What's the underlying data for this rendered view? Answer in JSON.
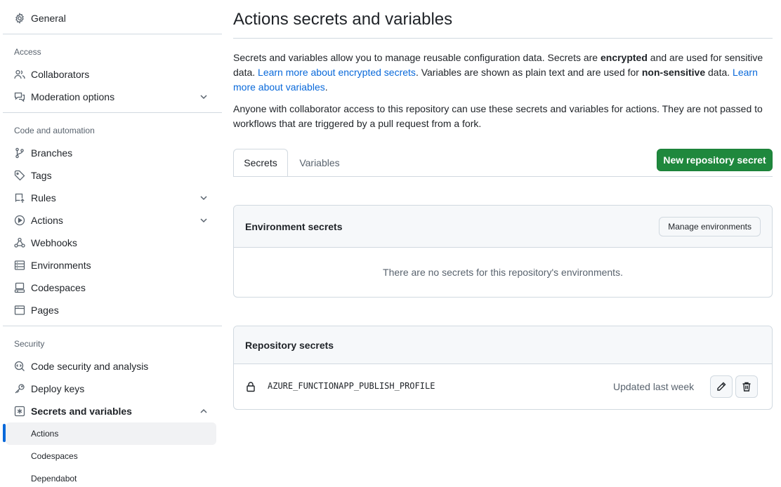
{
  "sidebar": {
    "top_item": {
      "label": "General",
      "icon": "gear-icon"
    },
    "sections": {
      "access": "Access",
      "code": "Code and automation",
      "security": "Security"
    },
    "items": {
      "collaborators": "Collaborators",
      "moderation": "Moderation options",
      "branches": "Branches",
      "tags": "Tags",
      "rules": "Rules",
      "actions": "Actions",
      "webhooks": "Webhooks",
      "environments": "Environments",
      "codespaces": "Codespaces",
      "pages": "Pages",
      "code_security": "Code security and analysis",
      "deploy_keys": "Deploy keys",
      "secrets_vars": "Secrets and variables"
    },
    "sub_items": {
      "actions": "Actions",
      "codespaces": "Codespaces",
      "dependabot": "Dependabot"
    }
  },
  "main": {
    "title": "Actions secrets and variables",
    "intro": {
      "p1_a": "Secrets and variables allow you to manage reusable configuration data. Secrets are ",
      "p1_b": "encrypted",
      "p1_c": " and are used for sensitive data. ",
      "p1_link1": "Learn more about encrypted secrets",
      "p1_d": ". Variables are shown as plain text and are used for ",
      "p1_e": "non-sensitive",
      "p1_f": " data. ",
      "p1_link2": "Learn more about variables",
      "p1_g": ".",
      "p2": "Anyone with collaborator access to this repository can use these secrets and variables for actions. They are not passed to workflows that are triggered by a pull request from a fork."
    },
    "tabs": [
      "Secrets",
      "Variables"
    ],
    "new_secret_button": "New repository secret",
    "environment_secrets": {
      "title": "Environment secrets",
      "manage_button": "Manage environments",
      "empty": "There are no secrets for this repository's environments."
    },
    "repository_secrets": {
      "title": "Repository secrets",
      "rows": [
        {
          "name": "AZURE_FUNCTIONAPP_PUBLISH_PROFILE",
          "updated": "Updated last week"
        }
      ]
    }
  }
}
